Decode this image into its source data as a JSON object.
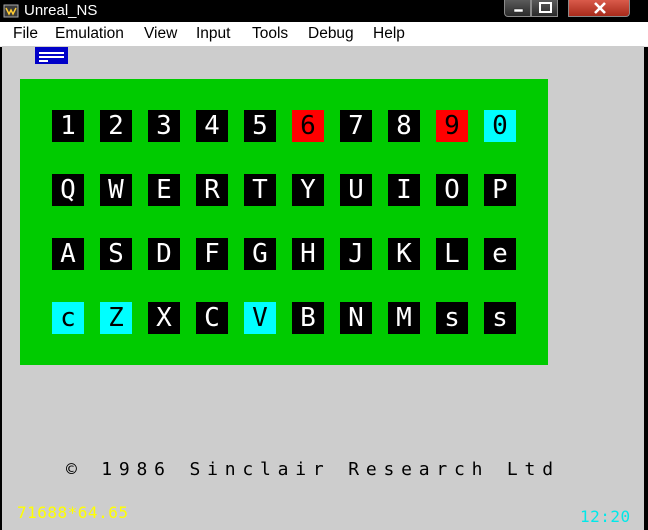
{
  "window": {
    "title": "Unreal_NS"
  },
  "menu": [
    "File",
    "Emulation",
    "View",
    "Input",
    "Tools",
    "Debug",
    "Help"
  ],
  "keyboard": {
    "rows": [
      [
        {
          "label": "1",
          "color": "black"
        },
        {
          "label": "2",
          "color": "black"
        },
        {
          "label": "3",
          "color": "black"
        },
        {
          "label": "4",
          "color": "black"
        },
        {
          "label": "5",
          "color": "black"
        },
        {
          "label": "6",
          "color": "red"
        },
        {
          "label": "7",
          "color": "black"
        },
        {
          "label": "8",
          "color": "black"
        },
        {
          "label": "9",
          "color": "red"
        },
        {
          "label": "0",
          "color": "cyan"
        }
      ],
      [
        {
          "label": "Q",
          "color": "black"
        },
        {
          "label": "W",
          "color": "black"
        },
        {
          "label": "E",
          "color": "black"
        },
        {
          "label": "R",
          "color": "black"
        },
        {
          "label": "T",
          "color": "black"
        },
        {
          "label": "Y",
          "color": "black"
        },
        {
          "label": "U",
          "color": "black"
        },
        {
          "label": "I",
          "color": "black"
        },
        {
          "label": "O",
          "color": "black"
        },
        {
          "label": "P",
          "color": "black"
        }
      ],
      [
        {
          "label": "A",
          "color": "black"
        },
        {
          "label": "S",
          "color": "black"
        },
        {
          "label": "D",
          "color": "black"
        },
        {
          "label": "F",
          "color": "black"
        },
        {
          "label": "G",
          "color": "black"
        },
        {
          "label": "H",
          "color": "black"
        },
        {
          "label": "J",
          "color": "black"
        },
        {
          "label": "K",
          "color": "black"
        },
        {
          "label": "L",
          "color": "black"
        },
        {
          "label": "e",
          "color": "black"
        }
      ],
      [
        {
          "label": "c",
          "color": "cyan"
        },
        {
          "label": "Z",
          "color": "cyan"
        },
        {
          "label": "X",
          "color": "black"
        },
        {
          "label": "C",
          "color": "black"
        },
        {
          "label": "V",
          "color": "cyan"
        },
        {
          "label": "B",
          "color": "black"
        },
        {
          "label": "N",
          "color": "black"
        },
        {
          "label": "M",
          "color": "black"
        },
        {
          "label": "s",
          "color": "black"
        },
        {
          "label": "s",
          "color": "black"
        }
      ]
    ]
  },
  "copyright": "© 1986 Sinclair Research Ltd",
  "status": {
    "perf": "71688*64.65",
    "clock": "12:20"
  },
  "colors": {
    "border": "#cdcdcd",
    "paper": "#00cb00",
    "key_black": "#000000",
    "key_red": "#ff0000",
    "key_cyan": "#00ffff",
    "perf_text": "#ffff00",
    "clock_text": "#00e8e8"
  },
  "icons": {
    "app": "unreal-app-icon",
    "minimize": "minimize-icon",
    "maximize": "maximize-icon",
    "close": "close-icon",
    "status": "disk-status-icon"
  }
}
